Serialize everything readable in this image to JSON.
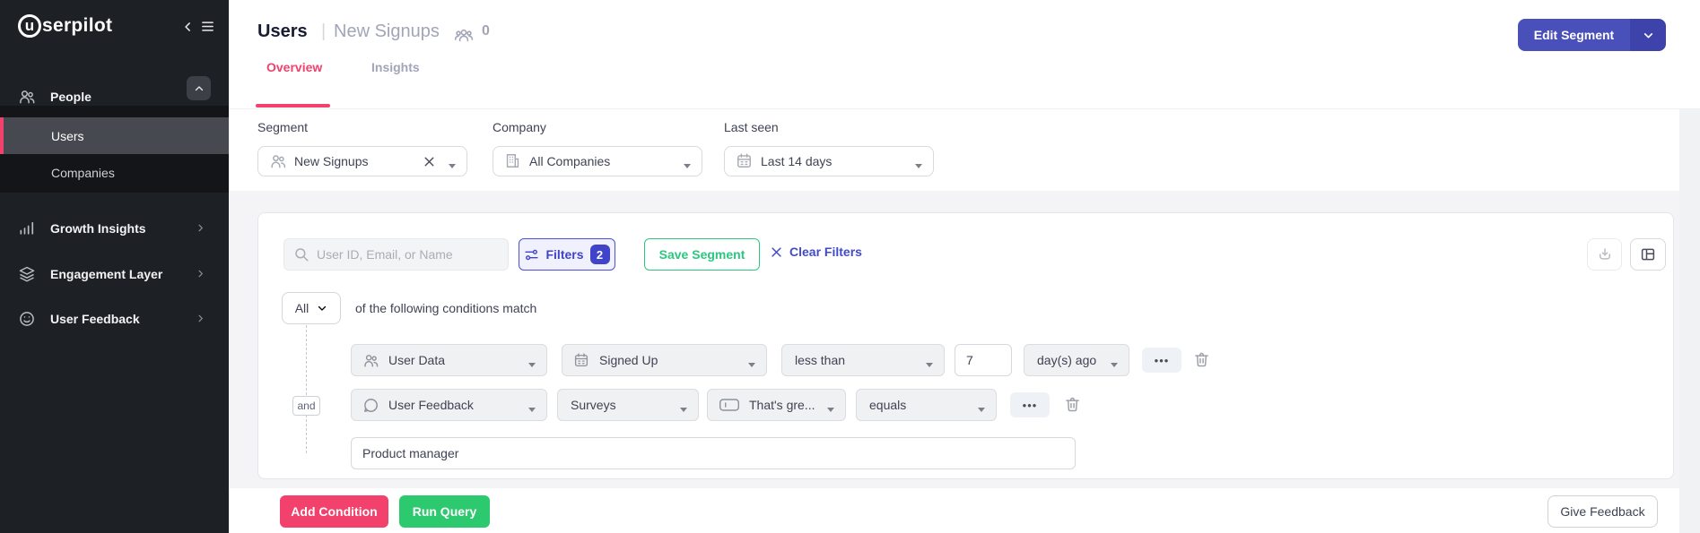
{
  "sidebar": {
    "logo": {
      "initial": "u",
      "rest": "serpilot"
    },
    "items": [
      {
        "label": "People"
      },
      {
        "label": "Users"
      },
      {
        "label": "Companies"
      },
      {
        "label": "Growth Insights"
      },
      {
        "label": "Engagement Layer"
      },
      {
        "label": "User Feedback"
      }
    ]
  },
  "header": {
    "title": "Users",
    "divider": "|",
    "segment_name": "New Signups",
    "segment_count": "0",
    "edit_segment_label": "Edit Segment",
    "tabs": [
      {
        "label": "Overview"
      },
      {
        "label": "Insights"
      }
    ]
  },
  "filter_bar": {
    "segment": {
      "label": "Segment",
      "value": "New Signups"
    },
    "company": {
      "label": "Company",
      "value": "All Companies"
    },
    "last_seen": {
      "label": "Last seen",
      "value": "Last 14 days"
    }
  },
  "toolbar": {
    "search_placeholder": "User ID, Email, or Name",
    "filters_label": "Filters",
    "filters_count": "2",
    "save_segment_label": "Save Segment",
    "clear_filters_label": "Clear Filters"
  },
  "query": {
    "match_mode": "All",
    "match_text": "of the following conditions match",
    "connector": "and",
    "more_options": "•••",
    "row1": {
      "field": "User Data",
      "attribute": "Signed Up",
      "operator": "less than",
      "value": "7",
      "unit": "day(s) ago"
    },
    "row2": {
      "field": "User Feedback",
      "attribute": "Surveys",
      "question": "That's gre...",
      "operator": "equals",
      "answer": "Product manager"
    }
  },
  "footer": {
    "add_condition_label": "Add Condition",
    "run_query_label": "Run Query",
    "give_feedback_label": "Give Feedback"
  },
  "colors": {
    "pink": "#f1416c",
    "indigo": "#4a50ba",
    "indigo_bright": "#4c51db",
    "green": "#2bc77f"
  }
}
